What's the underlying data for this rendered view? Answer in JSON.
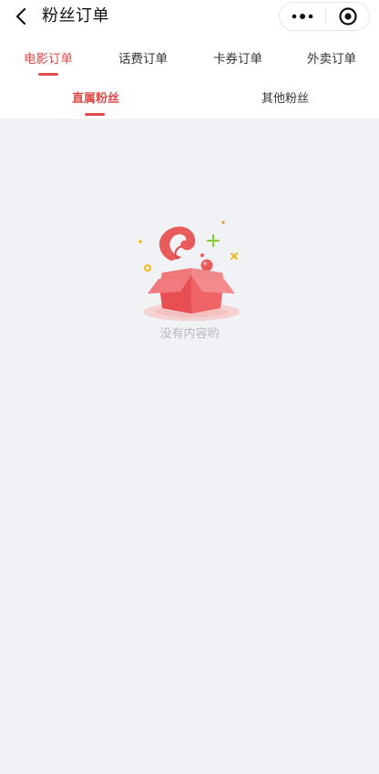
{
  "navbar": {
    "title": "粉丝订单",
    "back_icon": "chevron-left-icon",
    "more_icon": "more-dots-icon",
    "close_icon": "target-circle-icon"
  },
  "tabs": [
    {
      "label": "电影订单",
      "active": true
    },
    {
      "label": "话费订单",
      "active": false
    },
    {
      "label": "卡券订单",
      "active": false
    },
    {
      "label": "外卖订单",
      "active": false
    }
  ],
  "subtabs": [
    {
      "label": "直属粉丝",
      "active": true
    },
    {
      "label": "其他粉丝",
      "active": false
    }
  ],
  "empty_state": {
    "icon": "open-box-icon",
    "message": "没有内容哟"
  },
  "colors": {
    "accent": "#e04a4a",
    "background": "#f0f2f6",
    "empty_text": "#b7b9bf"
  }
}
